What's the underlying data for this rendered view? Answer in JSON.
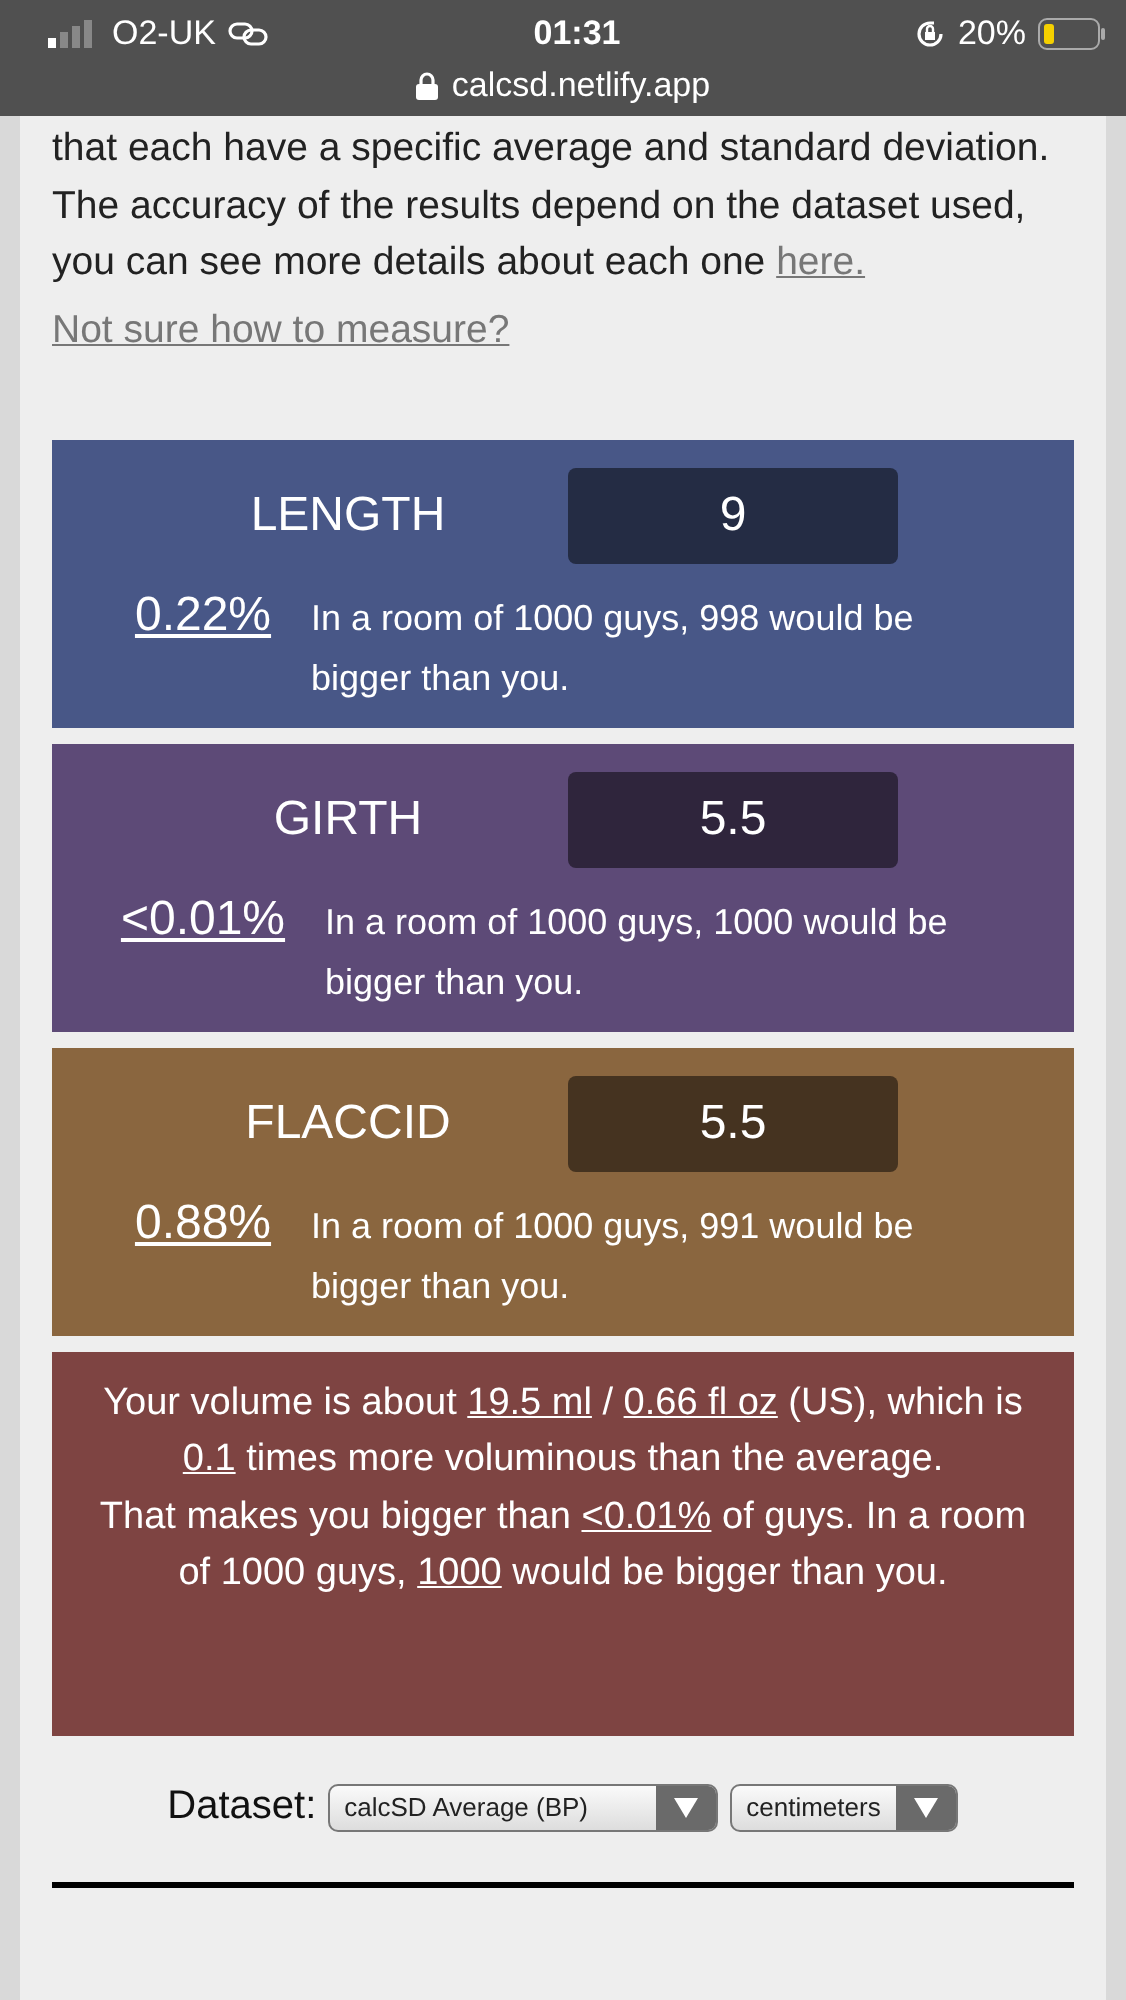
{
  "status_bar": {
    "carrier": "O2-UK",
    "time": "01:31",
    "battery": "20%"
  },
  "address_bar": {
    "url": "calcsd.netlify.app"
  },
  "intro": {
    "text": "that each have a specific average and standard deviation. The accuracy of the results depend on the dataset used, you can see more details about each one",
    "link": "here."
  },
  "measure_link": "Not sure how to measure?",
  "measurements": [
    {
      "label": "LENGTH",
      "value": "9",
      "percent": "0.22%",
      "description": "In a room of 1000 guys, 998 would be bigger than you.",
      "color": "#485787"
    },
    {
      "label": "GIRTH",
      "value": "5.5",
      "percent": "<0.01%",
      "description": "In a room of 1000 guys, 1000 would be bigger than you.",
      "color": "#5d4a77"
    },
    {
      "label": "FLACCID",
      "value": "5.5",
      "percent": "0.88%",
      "description": "In a room of 1000 guys, 991 would be bigger than you.",
      "color": "#8a663f"
    }
  ],
  "volume": {
    "lines": [
      [
        {
          "kind": "plain",
          "text": "Your volume is about "
        },
        {
          "kind": "value",
          "text": "19.5 ml"
        },
        {
          "kind": "plain",
          "text": " / "
        },
        {
          "kind": "value",
          "text": "0.66 fl oz"
        },
        {
          "kind": "plain",
          "text": " (US), which is "
        },
        {
          "kind": "value",
          "text": "0.1"
        },
        {
          "kind": "plain",
          "text": " times more voluminous than the average."
        }
      ],
      [
        {
          "kind": "plain",
          "text": "That makes you bigger than "
        },
        {
          "kind": "value",
          "text": "<0.01%"
        },
        {
          "kind": "plain",
          "text": " of guys. In a room of 1000 guys, "
        },
        {
          "kind": "value",
          "text": "1000"
        },
        {
          "kind": "plain",
          "text": " would be bigger than you."
        }
      ]
    ]
  },
  "dataset": {
    "label": "Dataset:",
    "source": "calcSD Average (BP)",
    "unit": "centimeters"
  }
}
